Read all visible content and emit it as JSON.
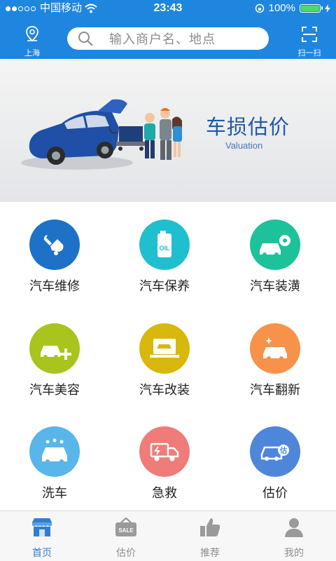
{
  "status": {
    "carrier": "中国移动",
    "time": "23:43",
    "battery": "100%"
  },
  "header": {
    "location_label": "上海",
    "search_placeholder": "输入商户名、地点",
    "scan_label": "扫一扫"
  },
  "banner": {
    "title": "车损估价",
    "subtitle": "Valuation"
  },
  "services": [
    {
      "label": "汽车维修",
      "icon": "wrench-car-icon",
      "color": "#1d72c8"
    },
    {
      "label": "汽车保养",
      "icon": "oil-can-icon",
      "color": "#1fbfd0"
    },
    {
      "label": "汽车装潢",
      "icon": "car-gear-icon",
      "color": "#1ec29a"
    },
    {
      "label": "汽车美容",
      "icon": "car-plus-icon",
      "color": "#a9c41c"
    },
    {
      "label": "汽车改装",
      "icon": "laptop-car-icon",
      "color": "#d8b80d"
    },
    {
      "label": "汽车翻新",
      "icon": "car-sparkle-icon",
      "color": "#f7924a"
    },
    {
      "label": "洗车",
      "icon": "car-wash-icon",
      "color": "#59b6ea"
    },
    {
      "label": "急救",
      "icon": "ambulance-truck-icon",
      "color": "#ef7c79"
    },
    {
      "label": "估价",
      "icon": "car-valuation-icon",
      "color": "#4e86da"
    }
  ],
  "bottom_nav": [
    {
      "label": "首页",
      "icon": "shop-icon",
      "active": true
    },
    {
      "label": "估价",
      "icon": "sale-tag-icon",
      "active": false,
      "icon_text": "SALE"
    },
    {
      "label": "推荐",
      "icon": "thumbs-up-icon",
      "active": false
    },
    {
      "label": "我的",
      "icon": "user-icon",
      "active": false
    }
  ]
}
